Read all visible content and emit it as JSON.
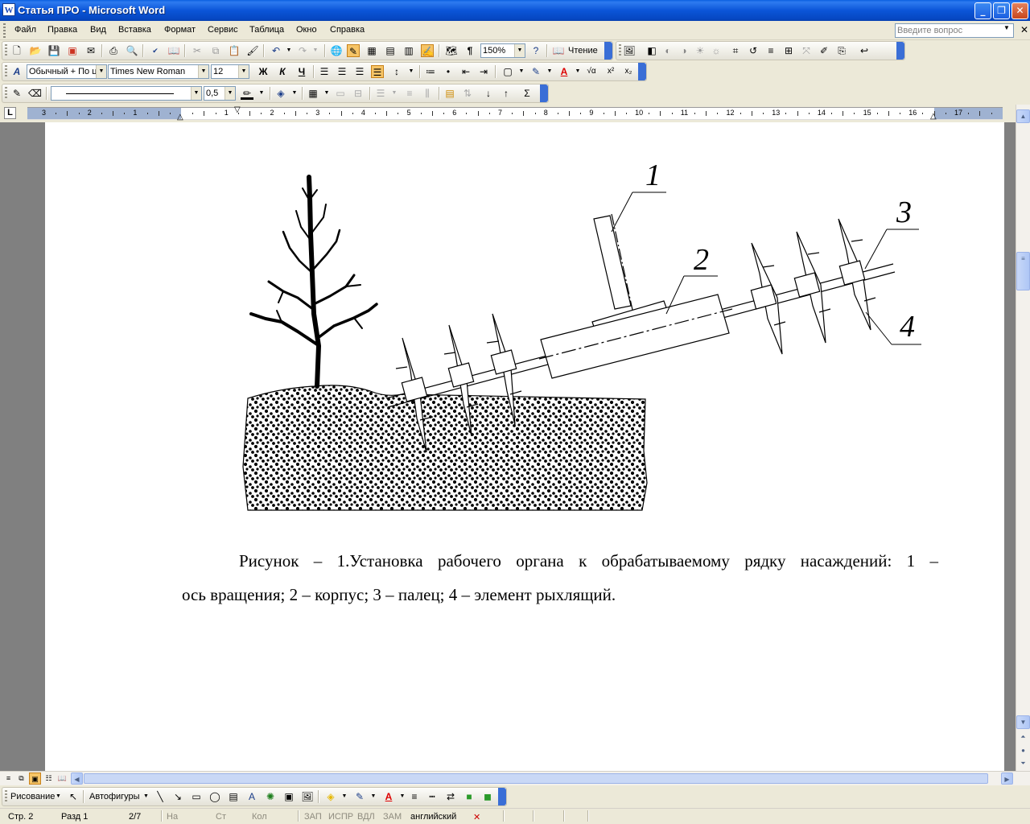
{
  "window": {
    "title": "Статья ПРО - Microsoft Word",
    "app_icon": "W",
    "min": "_",
    "max": "❐",
    "close": "✕"
  },
  "menu": {
    "items": [
      "Файл",
      "Правка",
      "Вид",
      "Вставка",
      "Формат",
      "Сервис",
      "Таблица",
      "Окно",
      "Справка"
    ],
    "ask_placeholder": "Введите вопрос"
  },
  "toolbar": {
    "zoom": "150%",
    "reading_label": "Чтение",
    "style": "Обычный + По ц",
    "font": "Times New Roman",
    "size": "12",
    "bold": "Ж",
    "italic": "К",
    "underline": "Ч",
    "line_weight": "0,5"
  },
  "ruler": {
    "ticks": [
      "3",
      "2",
      "1",
      "",
      "1",
      "2",
      "3",
      "4",
      "5",
      "6",
      "7",
      "8",
      "9",
      "10",
      "11",
      "12",
      "13",
      "14",
      "15",
      "16",
      "17"
    ]
  },
  "figure": {
    "labels": [
      "1",
      "2",
      "3",
      "4"
    ]
  },
  "caption": {
    "line1": "Рисунок – 1.Установка рабочего органа к обрабатываемому рядку насаждений: 1 –",
    "line2": "ось вращения; 2 – корпус; 3 – палец; 4 – элемент рыхлящий."
  },
  "drawing_toolbar": {
    "drawing": "Рисование",
    "autoshapes": "Автофигуры"
  },
  "status": {
    "page": "Стр. 2",
    "section": "Разд 1",
    "pages": "2/7",
    "at": "На",
    "line": "Ст",
    "col": "Кол",
    "rec": "ЗАП",
    "trk": "ИСПР",
    "ext": "ВДЛ",
    "ovr": "ЗАМ",
    "language": "английский"
  }
}
